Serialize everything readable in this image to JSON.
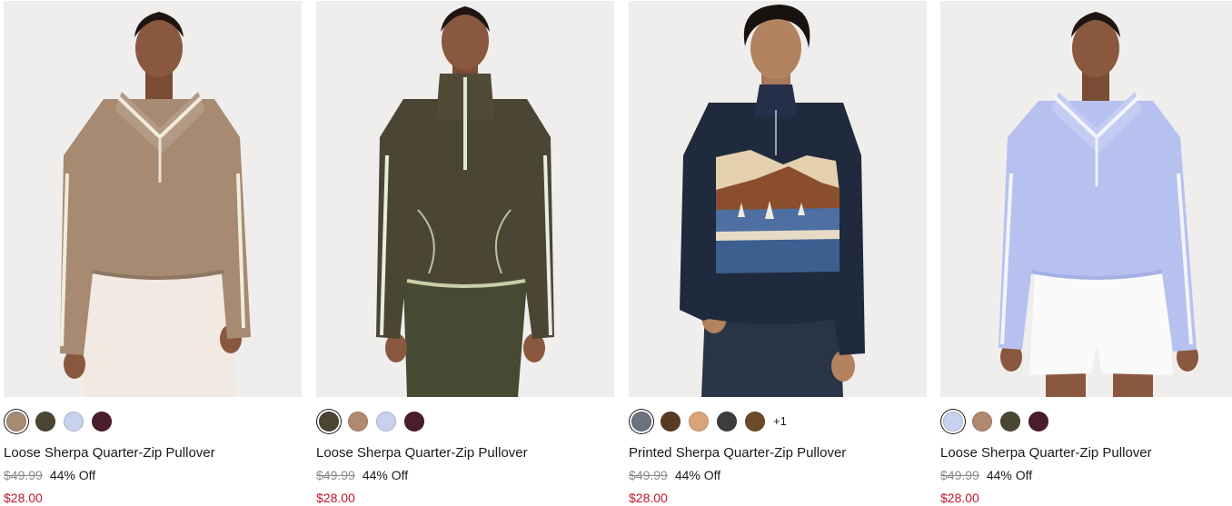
{
  "products": [
    {
      "title": "Loose Sherpa Quarter-Zip Pullover",
      "original_price": "$49.99",
      "discount": "44% Off",
      "sale_price": "$28.00",
      "swatches": [
        {
          "color": "#a68a72",
          "selected": true
        },
        {
          "color": "#4b4634",
          "selected": false
        },
        {
          "color": "#c8d2ee",
          "selected": false
        },
        {
          "color": "#4a1d2e",
          "selected": false
        }
      ],
      "more_colors": ""
    },
    {
      "title": "Loose Sherpa Quarter-Zip Pullover",
      "original_price": "$49.99",
      "discount": "44% Off",
      "sale_price": "$28.00",
      "swatches": [
        {
          "color": "#4b4634",
          "selected": true
        },
        {
          "color": "#b08a70",
          "selected": false
        },
        {
          "color": "#c8d2ee",
          "selected": false
        },
        {
          "color": "#4a1d2e",
          "selected": false
        }
      ],
      "more_colors": ""
    },
    {
      "title": "Printed Sherpa Quarter-Zip Pullover",
      "original_price": "$49.99",
      "discount": "44% Off",
      "sale_price": "$28.00",
      "swatches": [
        {
          "color": "#6b7280",
          "selected": true
        },
        {
          "color": "#5a3b22",
          "selected": false
        },
        {
          "color": "#d9a47a",
          "selected": false
        },
        {
          "color": "#3d3d3d",
          "selected": false
        },
        {
          "color": "#6b4a2a",
          "selected": false
        }
      ],
      "more_colors": "+1"
    },
    {
      "title": "Loose Sherpa Quarter-Zip Pullover",
      "original_price": "$49.99",
      "discount": "44% Off",
      "sale_price": "$28.00",
      "swatches": [
        {
          "color": "#c8d2ee",
          "selected": true
        },
        {
          "color": "#b08a70",
          "selected": false
        },
        {
          "color": "#4b4634",
          "selected": false
        },
        {
          "color": "#4a1d2e",
          "selected": false
        }
      ],
      "more_colors": ""
    }
  ],
  "colors": {
    "sale_red": "#c0142a",
    "strike_gray": "#8a8a8a"
  }
}
